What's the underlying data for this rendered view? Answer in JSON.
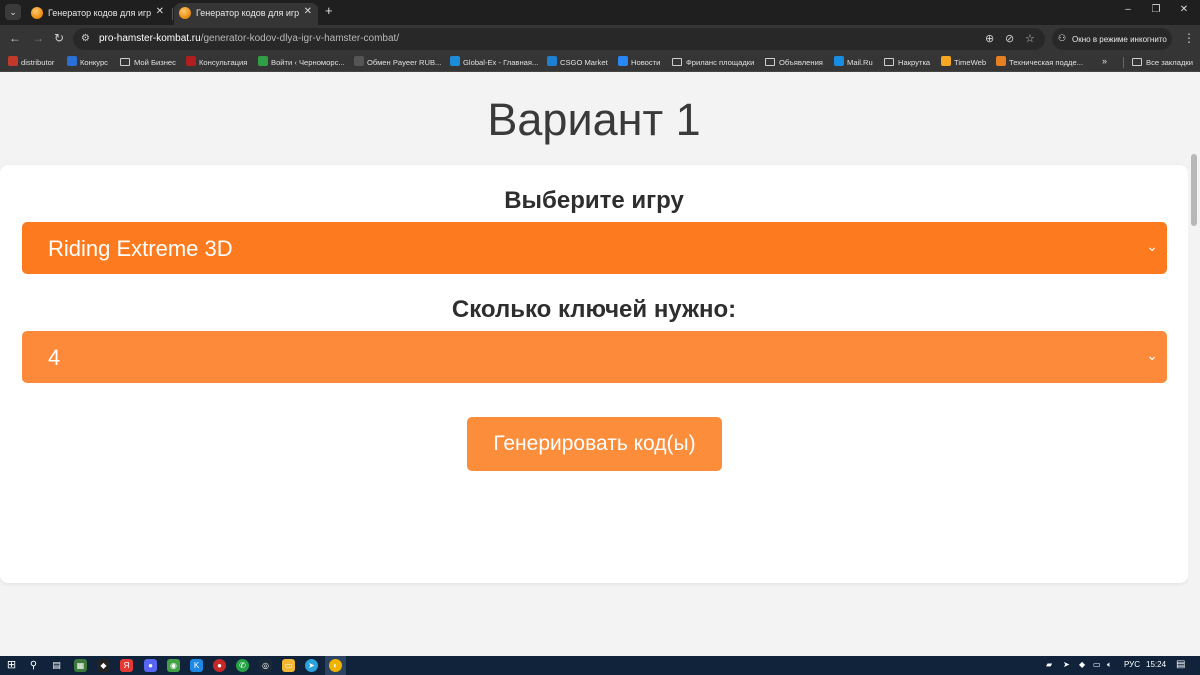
{
  "browser": {
    "tabs": [
      {
        "title": "Генератор кодов для игр в Hamster Kombat"
      },
      {
        "title": "Генератор кодов для игр в Hamster Kombat"
      }
    ],
    "url_host": "pro-hamster-kombat.ru",
    "url_path": "/generator-kodov-dlya-igr-v-hamster-combat/",
    "incognito_label": "Окно в режиме инкогнито",
    "bookmarks": [
      {
        "label": "distributor",
        "color": "#c0392b"
      },
      {
        "label": "Конкурс",
        "color": "#2a6fd6"
      },
      {
        "label": "Мой Бизнес",
        "folder": true
      },
      {
        "label": "Консультация",
        "color": "#b01e1e"
      },
      {
        "label": "Войти ‹ Черноморс...",
        "color": "#2f9e44"
      },
      {
        "label": "Обмен Payeer RUB...",
        "color": "#555555"
      },
      {
        "label": "Global-Ex - Главная...",
        "color": "#1c8bd8"
      },
      {
        "label": "CSGO Market",
        "color": "#1f7fd1"
      },
      {
        "label": "Новости",
        "color": "#2787f5"
      },
      {
        "label": "Фриланс площадки",
        "folder": true
      },
      {
        "label": "Объявления",
        "folder": true
      },
      {
        "label": "Mail.Ru",
        "color": "#168de2"
      },
      {
        "label": "Накрутка",
        "folder": true
      },
      {
        "label": "TimeWeb",
        "color": "#f5a623"
      },
      {
        "label": "Техническая подде...",
        "color": "#e67e22"
      }
    ],
    "more_label": "»",
    "all_bookmarks_label": "Все закладки"
  },
  "page": {
    "title": "Вариант 1",
    "game_label": "Выберите игру",
    "game_selected": "Riding Extreme 3D",
    "keys_label": "Сколько ключей нужно:",
    "keys_selected": "4",
    "generate_button": "Генерировать код(ы)",
    "colors": {
      "game_select": "#fd7b1e",
      "keys_select": "#fd8a3a",
      "button": "#fb8d3b"
    }
  },
  "taskbar": {
    "language": "РУС",
    "time": "15:24"
  }
}
